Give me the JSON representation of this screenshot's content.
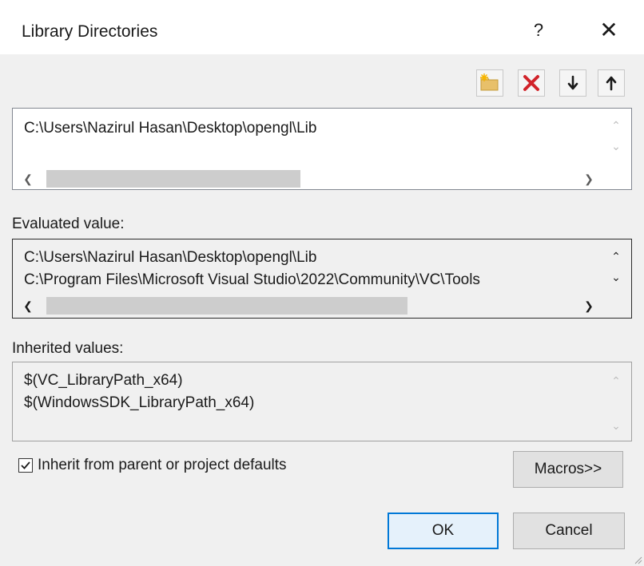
{
  "window": {
    "title": "Library Directories",
    "help_label": "?",
    "close_label": "✕"
  },
  "toolbar": {
    "buttons": [
      {
        "name": "new-line",
        "icon": "new-folder-icon"
      },
      {
        "name": "delete",
        "icon": "delete-x-icon",
        "color": "#d1232a"
      },
      {
        "name": "move-down",
        "icon": "arrow-down-icon"
      },
      {
        "name": "move-up",
        "icon": "arrow-up-icon"
      }
    ]
  },
  "edit_list": {
    "lines": [
      "C:\\Users\\Nazirul Hasan\\Desktop\\opengl\\Lib"
    ],
    "hscroll_position": 0
  },
  "evaluated": {
    "label": "Evaluated value:",
    "lines": [
      "C:\\Users\\Nazirul Hasan\\Desktop\\opengl\\Lib",
      "C:\\Program Files\\Microsoft Visual Studio\\2022\\Community\\VC\\Tools"
    ]
  },
  "inherited": {
    "label": "Inherited values:",
    "lines": [
      "$(VC_LibraryPath_x64)",
      "$(WindowsSDK_LibraryPath_x64)"
    ]
  },
  "inherit_checkbox": {
    "label": "Inherit from parent or project defaults",
    "checked": true
  },
  "buttons": {
    "macros": "Macros>>",
    "ok": "OK",
    "cancel": "Cancel"
  },
  "colors": {
    "accent": "#0078d7",
    "delete_red": "#d1232a"
  }
}
